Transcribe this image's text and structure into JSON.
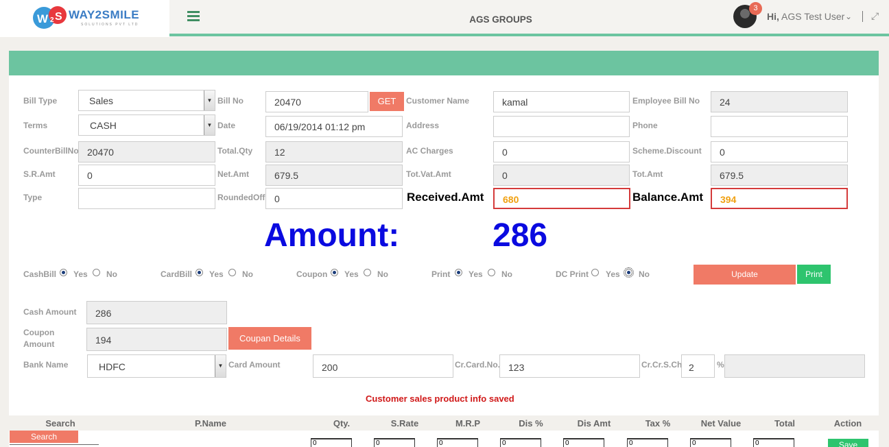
{
  "header": {
    "logo_text": "WAY2SMILE",
    "logo_sub": "SOLUTIONS PVT LTD",
    "logo_mark": "W2S",
    "app_title": "AGS GROUPS",
    "notification_count": "3",
    "greet_prefix": "Hi,",
    "user_name": "AGS Test User"
  },
  "form": {
    "bill_type": {
      "label": "Bill Type",
      "value": "Sales"
    },
    "bill_no": {
      "label": "Bill No",
      "value": "20470",
      "button": "GET"
    },
    "customer_name": {
      "label": "Customer Name",
      "value": "kamal"
    },
    "employee_bill_no": {
      "label": "Employee Bill No",
      "value": "24"
    },
    "terms": {
      "label": "Terms",
      "value": "CASH"
    },
    "date": {
      "label": "Date",
      "value": "06/19/2014 01:12 pm"
    },
    "address": {
      "label": "Address",
      "value": ""
    },
    "phone": {
      "label": "Phone",
      "value": ""
    },
    "counter_bill_no": {
      "label": "CounterBillNo",
      "value": "20470"
    },
    "total_qty": {
      "label": "Total.Qty",
      "value": "12"
    },
    "ac_charges": {
      "label": "AC Charges",
      "value": "0"
    },
    "scheme_discount": {
      "label": "Scheme.Discount",
      "value": "0"
    },
    "sr_amt": {
      "label": "S.R.Amt",
      "value": "0"
    },
    "net_amt": {
      "label": "Net.Amt",
      "value": "679.5"
    },
    "tot_vat_amt": {
      "label": "Tot.Vat.Amt",
      "value": "0"
    },
    "tot_amt": {
      "label": "Tot.Amt",
      "value": "679.5"
    },
    "type": {
      "label": "Type",
      "value": ""
    },
    "rounded_off": {
      "label": "RoundedOff",
      "value": "0"
    },
    "received_amt": {
      "label": "Received.Amt",
      "value": "680"
    },
    "balance_amt": {
      "label": "Balance.Amt",
      "value": "394"
    }
  },
  "amount": {
    "label": "Amount:",
    "value": "286"
  },
  "options": {
    "yes": "Yes",
    "no": "No",
    "cash_bill": "CashBill",
    "card_bill": "CardBill",
    "coupon": "Coupon",
    "print": "Print",
    "dc_print": "DC Print"
  },
  "actions": {
    "update": "Update",
    "print": "Print"
  },
  "payment": {
    "cash_amount": {
      "label": "Cash Amount",
      "value": "286"
    },
    "coupon_amount": {
      "label_1": "Coupon",
      "label_2": "Amount",
      "value": "194",
      "button": "Coupan Details"
    },
    "bank_name": {
      "label": "Bank Name",
      "value": "HDFC"
    },
    "card_amount": {
      "label": "Card Amount",
      "value": "200"
    },
    "cr_card_no": {
      "label": "Cr.Card.No.",
      "value": "123"
    },
    "cr_cr_s_ch": {
      "label": "Cr.Cr.S.Ch",
      "value": "2",
      "unit": "%"
    }
  },
  "message": "Customer sales product info saved",
  "table": {
    "columns": [
      "Search",
      "P.Name",
      "Qty.",
      "S.Rate",
      "M.R.P",
      "Dis %",
      "Dis Amt",
      "Tax %",
      "Net Value",
      "Total",
      "Action"
    ],
    "search_button": "Search",
    "row_values": [
      "0",
      "0",
      "0",
      "0",
      "0",
      "0",
      "0",
      "0"
    ],
    "save_button": "Save"
  },
  "colors": {
    "accent_green": "#6cc4a0",
    "salmon": "#f07a66",
    "amount_blue": "#0a0ae0",
    "error_red": "#d01818"
  }
}
